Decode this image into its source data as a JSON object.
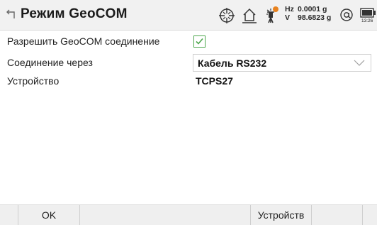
{
  "header": {
    "title": "Режим GeoCOM",
    "hz_label": "Hz",
    "hz_value": "0.0001 g",
    "v_label": "V",
    "v_value": "98.6823 g",
    "time": "13:26",
    "icons": [
      "back-icon",
      "crosshair-target-icon",
      "home-level-icon",
      "laser-plummet-icon",
      "at-sign-icon",
      "battery-icon"
    ]
  },
  "form": {
    "allow_label": "Разрешить GeoCOM соединение",
    "allow_checked": true,
    "connection_label": "Соединение через",
    "connection_value": "Кабель RS232",
    "device_label": "Устройство",
    "device_value": "TCPS27"
  },
  "softkeys": {
    "f1": "OK",
    "f2": "",
    "f3": "",
    "f4": "Устройств",
    "f5": "",
    "f6": ""
  },
  "colors": {
    "check_green": "#4ca64c",
    "laser_orange": "#e8821f"
  }
}
